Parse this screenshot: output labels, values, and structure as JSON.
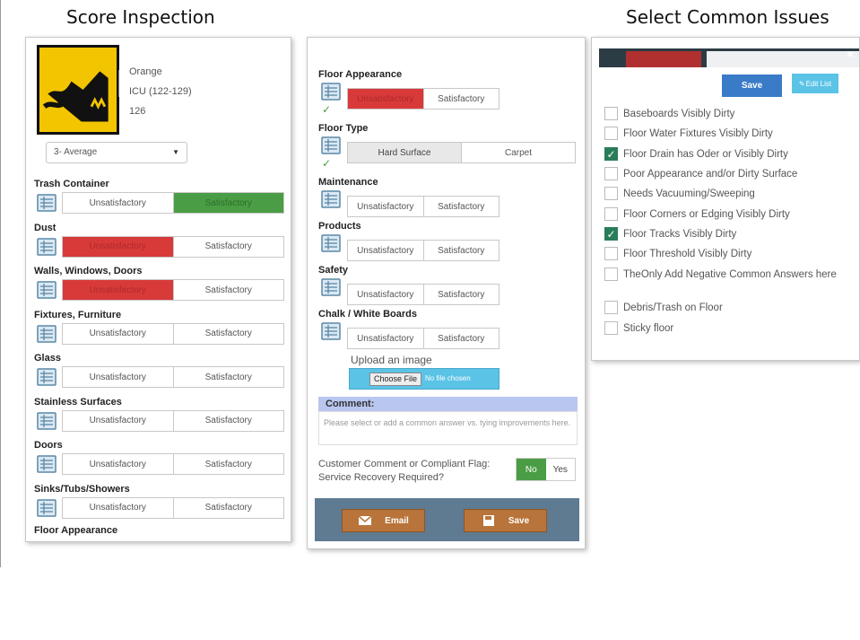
{
  "headings": {
    "left": "Score Inspection",
    "right": "Select Common Issues"
  },
  "location": {
    "name": "Orange",
    "unit": "ICU (122-129)",
    "room": "126"
  },
  "rating_select": {
    "value": "3- Average"
  },
  "options": {
    "bad": "Unsatisfactory",
    "good": "Satisfactory",
    "hard": "Hard Surface",
    "carpet": "Carpet"
  },
  "left_categories": [
    {
      "label": "Trash Container",
      "state": "good"
    },
    {
      "label": "Dust",
      "state": "bad"
    },
    {
      "label": "Walls, Windows, Doors",
      "state": "bad"
    },
    {
      "label": "Fixtures, Furniture",
      "state": "none"
    },
    {
      "label": "Glass",
      "state": "none"
    },
    {
      "label": "Stainless Surfaces",
      "state": "none"
    },
    {
      "label": "Doors",
      "state": "none"
    },
    {
      "label": "Sinks/Tubs/Showers",
      "state": "none"
    }
  ],
  "left_cut_label": "Floor Appearance",
  "mid_categories": [
    {
      "label": "Floor Appearance",
      "state": "bad"
    },
    {
      "label": "Floor Type",
      "state": "hard"
    },
    {
      "label": "Maintenance",
      "state": "none"
    },
    {
      "label": "Products",
      "state": "none"
    },
    {
      "label": "Safety",
      "state": "none"
    },
    {
      "label": "Chalk / White Boards",
      "state": "none"
    }
  ],
  "upload": {
    "title": "Upload an image",
    "button": "Choose File",
    "status": "No file chosen"
  },
  "comment": {
    "heading": "Comment:",
    "placeholder": "Please select or add a common answer vs. tying improvements here."
  },
  "flag": {
    "text": "Customer Comment or Compliant Flag: Service Recovery Required?",
    "no": "No",
    "yes": "Yes",
    "selected": "No"
  },
  "footer": {
    "email": "Email",
    "save": "Save"
  },
  "issues_panel": {
    "close": "×",
    "save": "Save",
    "edit": "Edit List",
    "items": [
      {
        "label": "Baseboards Visibly Dirty",
        "checked": false
      },
      {
        "label": "Floor Water Fixtures Visibly Dirty",
        "checked": false
      },
      {
        "label": "Floor Drain has Oder or Visibly Dirty",
        "checked": true
      },
      {
        "label": "Poor Appearance and/or Dirty Surface",
        "checked": false
      },
      {
        "label": "Needs Vacuuming/Sweeping",
        "checked": false
      },
      {
        "label": "Floor Corners or Edging Visibly Dirty",
        "checked": false
      },
      {
        "label": "Floor Tracks Visibly Dirty",
        "checked": true
      },
      {
        "label": "Floor Threshold Visibly Dirty",
        "checked": false
      },
      {
        "label": "TheOnly Add Negative Common Answers here",
        "checked": false
      },
      {
        "label": "Debris/Trash on Floor",
        "checked": false
      },
      {
        "label": "Sticky floor",
        "checked": false
      }
    ]
  },
  "colors": {
    "red": "#d83a3a",
    "green": "#4a9d44",
    "blue": "#3a7bc8",
    "cyan": "#5bc3e6",
    "footer": "#5e7b92",
    "brown": "#b8743a"
  }
}
